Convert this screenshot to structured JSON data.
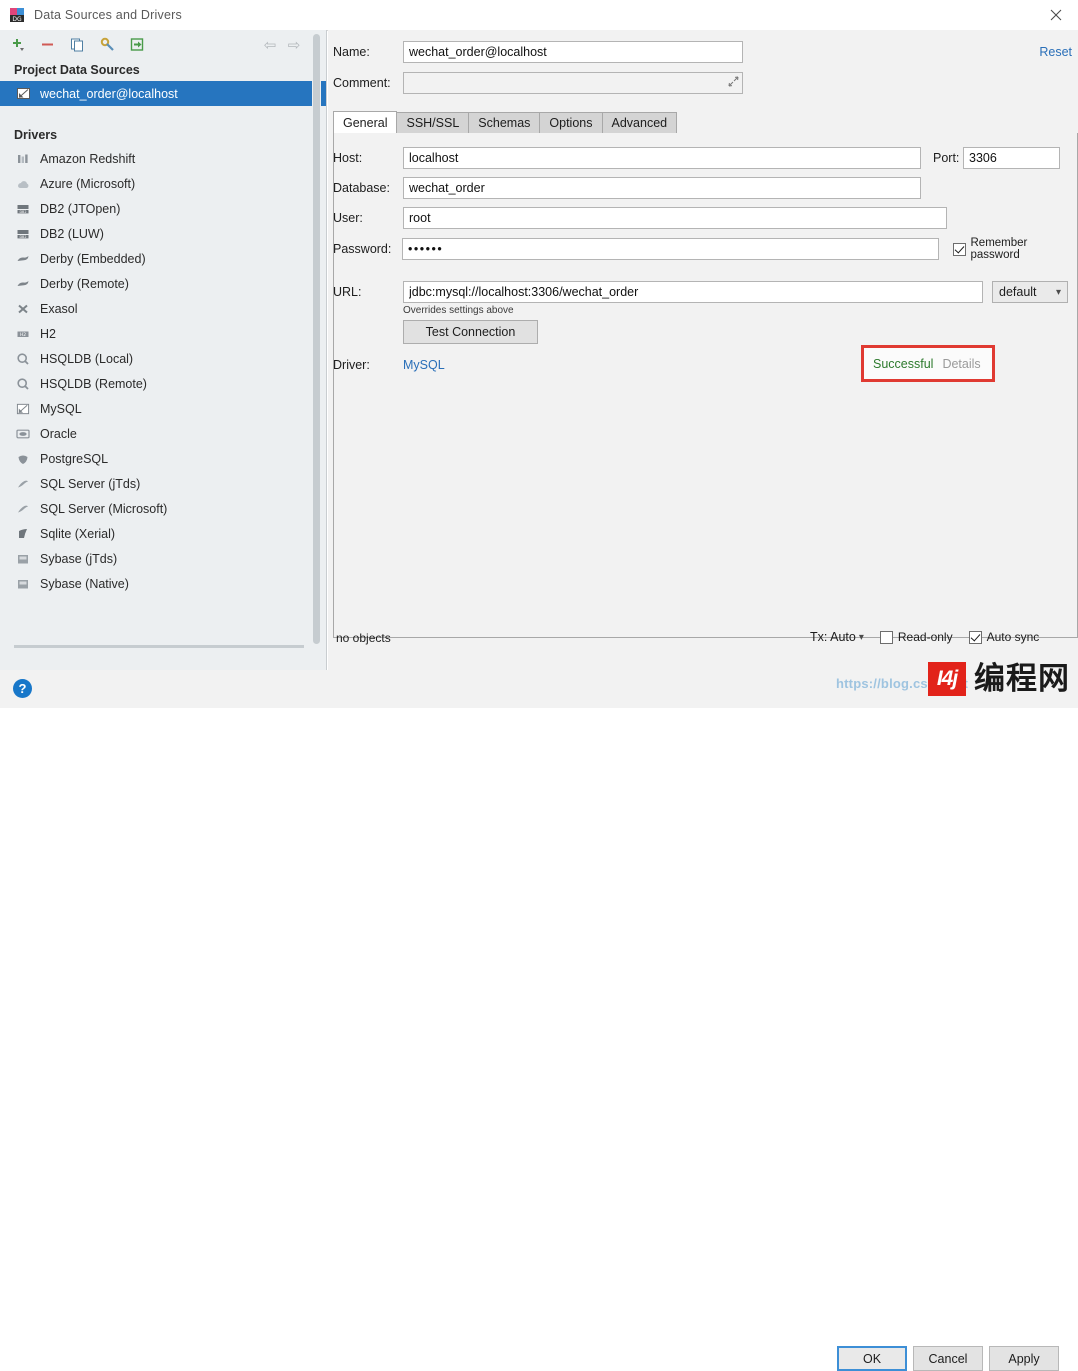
{
  "window": {
    "title": "Data Sources and Drivers",
    "app_icon": "datagrip-icon",
    "close_label": "✕"
  },
  "toolbar": {
    "buttons": [
      {
        "name": "add-button",
        "glyph": "+"
      },
      {
        "name": "remove-button",
        "glyph": "−"
      },
      {
        "name": "copy-button",
        "glyph": "copy-icon"
      },
      {
        "name": "driver-properties-button",
        "glyph": "wrench-icon"
      },
      {
        "name": "import-button",
        "glyph": "import-icon"
      }
    ],
    "nav_back": "⇦",
    "nav_forward": "⇨"
  },
  "sidebar": {
    "project_group_label": "Project Data Sources",
    "data_sources": [
      {
        "label": "wechat_order@localhost",
        "icon": "mysql-icon",
        "selected": true
      }
    ],
    "drivers_group_label": "Drivers",
    "drivers": [
      {
        "label": "Amazon Redshift",
        "icon": "redshift-icon"
      },
      {
        "label": "Azure (Microsoft)",
        "icon": "azure-icon"
      },
      {
        "label": "DB2 (JTOpen)",
        "icon": "db2-icon"
      },
      {
        "label": "DB2 (LUW)",
        "icon": "db2-icon"
      },
      {
        "label": "Derby (Embedded)",
        "icon": "derby-icon"
      },
      {
        "label": "Derby (Remote)",
        "icon": "derby-icon"
      },
      {
        "label": "Exasol",
        "icon": "exasol-icon"
      },
      {
        "label": "H2",
        "icon": "h2-icon"
      },
      {
        "label": "HSQLDB (Local)",
        "icon": "hsqldb-icon"
      },
      {
        "label": "HSQLDB (Remote)",
        "icon": "hsqldb-icon"
      },
      {
        "label": "MySQL",
        "icon": "mysql-icon"
      },
      {
        "label": "Oracle",
        "icon": "oracle-icon"
      },
      {
        "label": "PostgreSQL",
        "icon": "postgresql-icon"
      },
      {
        "label": "SQL Server (jTds)",
        "icon": "sqlserver-icon"
      },
      {
        "label": "SQL Server (Microsoft)",
        "icon": "sqlserver-icon"
      },
      {
        "label": "Sqlite (Xerial)",
        "icon": "sqlite-icon"
      },
      {
        "label": "Sybase (jTds)",
        "icon": "sybase-icon"
      },
      {
        "label": "Sybase (Native)",
        "icon": "sybase-icon"
      }
    ]
  },
  "form": {
    "name_label": "Name:",
    "name_value": "wechat_order@localhost",
    "comment_label": "Comment:",
    "comment_value": "",
    "reset_label": "Reset",
    "expand_icon": "expand-icon"
  },
  "tabs": [
    {
      "label": "General",
      "active": true
    },
    {
      "label": "SSH/SSL",
      "active": false
    },
    {
      "label": "Schemas",
      "active": false
    },
    {
      "label": "Options",
      "active": false
    },
    {
      "label": "Advanced",
      "active": false
    }
  ],
  "general": {
    "host_label": "Host:",
    "host_value": "localhost",
    "port_label": "Port:",
    "port_value": "3306",
    "database_label": "Database:",
    "database_value": "wechat_order",
    "user_label": "User:",
    "user_value": "root",
    "password_label": "Password:",
    "password_value": "••••••",
    "remember_password_label": "Remember password",
    "remember_password_checked": true,
    "url_label": "URL:",
    "url_value": "jdbc:mysql://localhost:3306/wechat_order",
    "url_hint": "Overrides settings above",
    "url_mode_value": "default",
    "test_connection_label": "Test Connection",
    "test_result": "Successful",
    "test_details_label": "Details",
    "driver_label": "Driver:",
    "driver_value": "MySQL"
  },
  "status": {
    "objects_text": "no objects",
    "tx_label": "Tx: Auto",
    "read_only_label": "Read-only",
    "read_only_checked": false,
    "auto_sync_label": "Auto sync",
    "auto_sync_checked": true
  },
  "footer": {
    "help_glyph": "?",
    "ok_label": "OK",
    "cancel_label": "Cancel",
    "apply_label": "Apply"
  },
  "watermark": {
    "url_text": "https://blog.csdn.net",
    "logo_mark": "I4j",
    "logo_text": "编程网"
  },
  "colors": {
    "selection_blue": "#2675bf",
    "success_green": "#2d7a2d",
    "highlight_red": "#e03a32",
    "link_blue": "#2a6fb8",
    "panel_bg": "#f2f2f2",
    "sidebar_bg": "#eceff1"
  }
}
